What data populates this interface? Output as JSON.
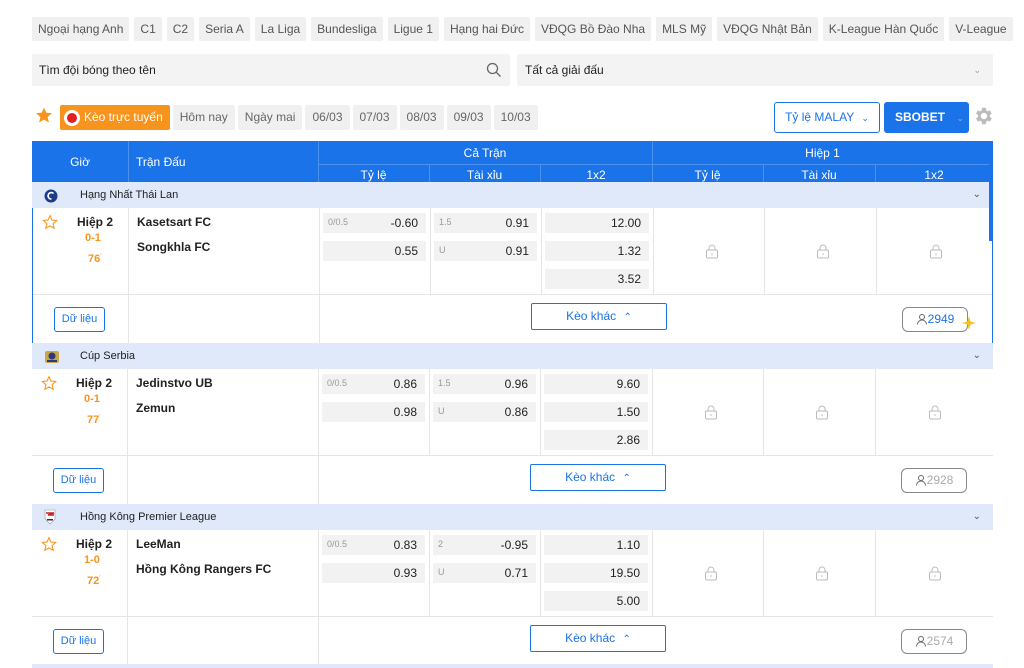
{
  "leagues": [
    "Ngoại hạng Anh",
    "C1",
    "C2",
    "Seria A",
    "La Liga",
    "Bundesliga",
    "Ligue 1",
    "Hạng hai Đức",
    "VĐQG Bồ Đào Nha",
    "MLS Mỹ",
    "VĐQG Nhật Bản",
    "K-League Hàn Quốc",
    "V-League"
  ],
  "search": {
    "placeholder": "Tìm đội bóng theo tên",
    "value": ""
  },
  "league_filter": "Tất cả giải đấu",
  "date_tabs": [
    "Kèo trực tuyến",
    "Hôm nay",
    "Ngày mai",
    "06/03",
    "07/03",
    "08/03",
    "09/03",
    "10/03"
  ],
  "odds_type": "Tỷ lệ MALAY",
  "bookmaker": "SBOBET",
  "table_header": {
    "time": "Giờ",
    "match": "Trận Đấu",
    "full_match": "Cả Trận",
    "first_half": "Hiệp 1",
    "handicap": "Tỷ lệ",
    "over_under": "Tài xỉu",
    "onextwo": "1x2"
  },
  "buttons": {
    "data": "Dữ liệu",
    "more": "Kèo khác"
  },
  "colors": {
    "primary": "#1a73e8",
    "accent": "#f7941d",
    "league_bg": "#dfe9f9"
  },
  "matches": [
    {
      "league": "Hạng Nhất Thái Lan",
      "league_icon": "thai-league-icon",
      "period": "Hiệp 2",
      "score": "0-1",
      "minute": "76",
      "home": "Kasetsart FC",
      "away": "Songkhla FC",
      "hdp_line": "0/0.5",
      "hdp_home": "-0.60",
      "hdp_away": "0.55",
      "ou_line": "1.5",
      "ou_under": "U",
      "ou_over_odds": "0.91",
      "ou_under_odds": "0.91",
      "x1": "12.00",
      "x2": "1.32",
      "xd": "3.52",
      "count": "2949"
    },
    {
      "league": "Cúp Serbia",
      "league_icon": "serbia-cup-icon",
      "period": "Hiệp 2",
      "score": "0-1",
      "minute": "77",
      "home": "Jedinstvo UB",
      "away": "Zemun",
      "hdp_line": "0/0.5",
      "hdp_home": "0.86",
      "hdp_away": "0.98",
      "ou_line": "1.5",
      "ou_under": "U",
      "ou_over_odds": "0.96",
      "ou_under_odds": "0.86",
      "x1": "9.60",
      "x2": "1.50",
      "xd": "2.86",
      "count": "2928"
    },
    {
      "league": "Hồng Kông Premier League",
      "league_icon": "hk-league-icon",
      "period": "Hiệp 2",
      "score": "1-0",
      "minute": "72",
      "home": "LeeMan",
      "away": "Hồng Kông Rangers FC",
      "hdp_line": "0/0.5",
      "hdp_home": "0.83",
      "hdp_away": "0.93",
      "ou_line": "2",
      "ou_under": "U",
      "ou_over_odds": "-0.95",
      "ou_under_odds": "0.71",
      "x1": "1.10",
      "x2": "19.50",
      "xd": "5.00",
      "count": "2574"
    }
  ]
}
